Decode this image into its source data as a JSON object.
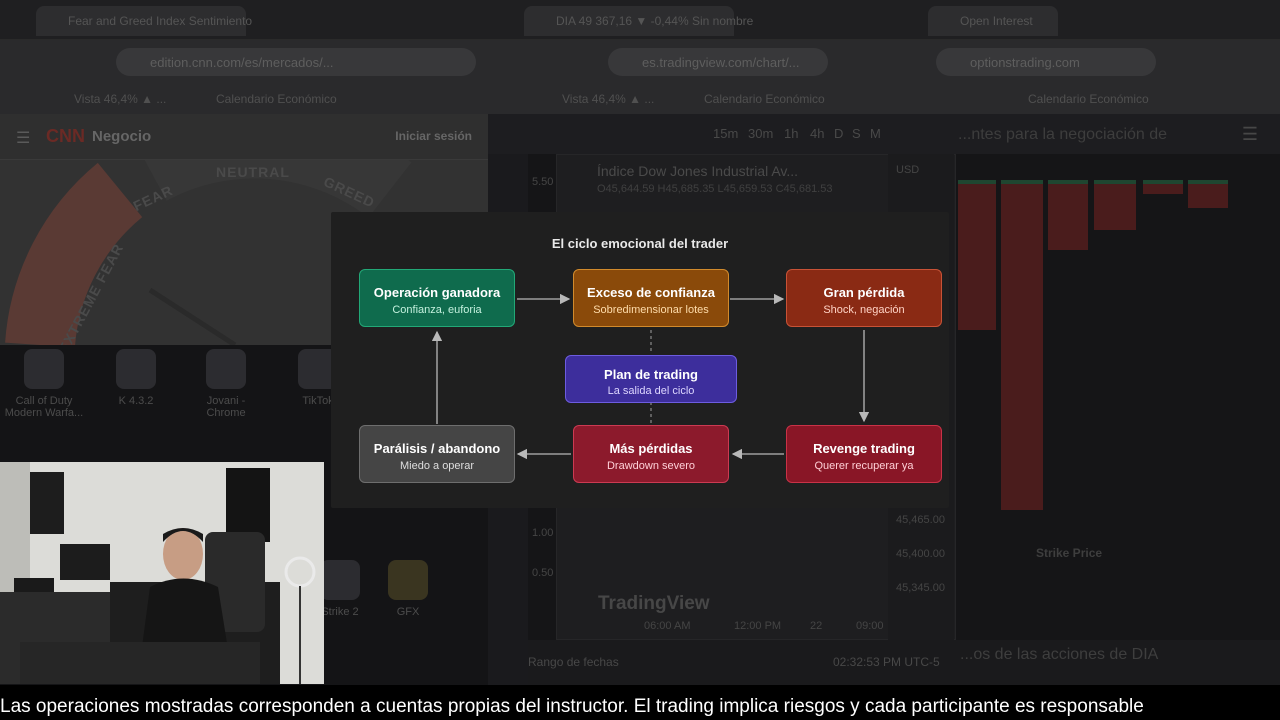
{
  "browser_left": {
    "tab_title": "Fear and Greed Index Sentimiento",
    "url": "edition.cnn.com/es/mercados/...",
    "bookmarks": [
      "Vista 46,4% ▲ ...",
      "Calendario Económico"
    ],
    "site_logo": "CNN",
    "site_section": "Negocio",
    "login": "Iniciar sesión",
    "gauge_labels": [
      "FEAR",
      "NEUTRAL",
      "GREED",
      "EXTREME FEAR"
    ]
  },
  "browser_right": {
    "tab_title": "DIA 49 367,16 ▼ -0,44% Sin nombre",
    "url": "es.tradingview.com/chart/...",
    "tab_title_2": "Open Interest",
    "url_2": "optionstrading.com",
    "bookmarks": [
      "Vista 46,4% ▲ ...",
      "Calendario Económico",
      "Calendario Económico"
    ]
  },
  "tradingview": {
    "timeframes": [
      "15m",
      "30m",
      "1h",
      "4h",
      "D",
      "S",
      "M"
    ],
    "symbol": "Índice Dow Jones Industrial Av...",
    "ohlc": "O45,644.59 H45,685.35 L45,659.53 C45,681.53",
    "currency": "USD",
    "price_ticks": [
      "45,465.00",
      "45,400.00",
      "45,345.00"
    ],
    "left_ticks": [
      "5.50",
      "1.00",
      "0.50"
    ],
    "time_ticks": [
      "06:00 AM",
      "12:00 PM",
      "22",
      "09:00"
    ],
    "date_range": "Rango de fechas",
    "clock": "02:32:53 PM UTC-5",
    "logo": "TradingView",
    "right_title": "...ntes para la negociación de",
    "strike_label": "Strike Price",
    "footer_right": "...os de las acciones de DIA"
  },
  "desktop_icons": [
    "Call of Duty Modern Warfa...",
    "K 4.3.2",
    "Jovani - Chrome",
    "TikTok",
    "Strike 2",
    "GFX"
  ],
  "diagram": {
    "title": "El ciclo emocional del trader",
    "nodes": [
      {
        "id": "ganadora",
        "title": "Operación ganadora",
        "subtitle": "Confianza, euforia"
      },
      {
        "id": "exceso",
        "title": "Exceso de confianza",
        "subtitle": "Sobredimensionar lotes"
      },
      {
        "id": "perdida",
        "title": "Gran pérdida",
        "subtitle": "Shock, negación"
      },
      {
        "id": "plan",
        "title": "Plan de trading",
        "subtitle": "La salida del ciclo"
      },
      {
        "id": "paralisis",
        "title": "Parálisis / abandono",
        "subtitle": "Miedo a operar"
      },
      {
        "id": "mas",
        "title": "Más pérdidas",
        "subtitle": "Drawdown severo"
      },
      {
        "id": "revenge",
        "title": "Revenge trading",
        "subtitle": "Querer recuperar ya"
      }
    ],
    "colors": {
      "ganadora": {
        "bg": "#0f6b4d",
        "border": "#22a877",
        "sub": "#c4f1de"
      },
      "exceso": {
        "bg": "#8a4a0a",
        "border": "#d18a2c",
        "sub": "#ffdcaa"
      },
      "perdida": {
        "bg": "#8a2a14",
        "border": "#c85236",
        "sub": "#ffd2c4"
      },
      "plan": {
        "bg": "#3d2e9c",
        "border": "#6d5ce0",
        "sub": "#ddd6ff"
      },
      "paralisis": {
        "bg": "#454545",
        "border": "#6e6e6e",
        "sub": "#dedede"
      },
      "mas": {
        "bg": "#8c1a2c",
        "border": "#cc3a52",
        "sub": "#ffd0d8"
      },
      "revenge": {
        "bg": "#891626",
        "border": "#c93247",
        "sub": "#ffd0d6"
      }
    },
    "arrow_color": "#b8b8b8"
  },
  "subtitle": "Las operaciones mostradas corresponden a cuentas propias del instructor. El trading implica riesgos y cada participante es responsable"
}
